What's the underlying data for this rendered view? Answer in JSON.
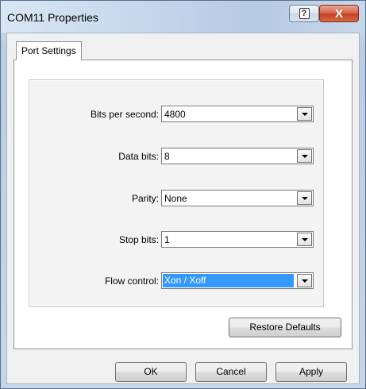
{
  "window": {
    "title": "COM11 Properties",
    "help_glyph": "?",
    "close_glyph": "X"
  },
  "tabs": [
    {
      "label": "Port Settings",
      "active": true
    }
  ],
  "fields": [
    {
      "label": "Bits per second:",
      "value": "4800",
      "selected": false
    },
    {
      "label": "Data bits:",
      "value": "8",
      "selected": false
    },
    {
      "label": "Parity:",
      "value": "None",
      "selected": false
    },
    {
      "label": "Stop bits:",
      "value": "1",
      "selected": false
    },
    {
      "label": "Flow control:",
      "value": "Xon / Xoff",
      "selected": true
    }
  ],
  "buttons": {
    "restore_defaults": "Restore Defaults",
    "ok": "OK",
    "cancel": "Cancel",
    "apply": "Apply"
  },
  "colors": {
    "selection": "#3399ff",
    "close_button": "#c2401f"
  }
}
